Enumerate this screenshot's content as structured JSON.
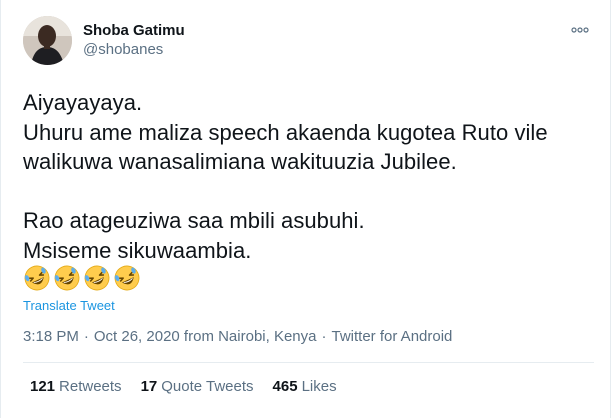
{
  "author": {
    "display_name": "Shoba Gatimu",
    "handle": "@shobanes",
    "avatar_icon": "profile-photo"
  },
  "more_icon": "more-options-icon",
  "tweet": {
    "lines": [
      "Aiyayayaya.",
      "Uhuru ame maliza speech akaenda kugotea Ruto vile",
      "walikuwa wanasalimiana wakituuzia Jubilee.",
      "",
      "Rao atageuziwa saa mbili asubuhi.",
      "Msiseme sikuwaambia."
    ],
    "emojis": [
      "rolling-on-the-floor-laughing",
      "rolling-on-the-floor-laughing",
      "rolling-on-the-floor-laughing",
      "rolling-on-the-floor-laughing"
    ],
    "translate_label": "Translate Tweet"
  },
  "meta": {
    "time": "3:18 PM",
    "separator": "·",
    "date_location": "Oct 26, 2020 from Nairobi, Kenya",
    "source": "Twitter for Android"
  },
  "stats": [
    {
      "count": "121",
      "label": "Retweets"
    },
    {
      "count": "17",
      "label": "Quote Tweets"
    },
    {
      "count": "465",
      "label": "Likes"
    }
  ],
  "colors": {
    "text": "#0f1419",
    "secondary": "#5b7083",
    "link": "#1b95e0",
    "divider": "#e6ecf0"
  }
}
